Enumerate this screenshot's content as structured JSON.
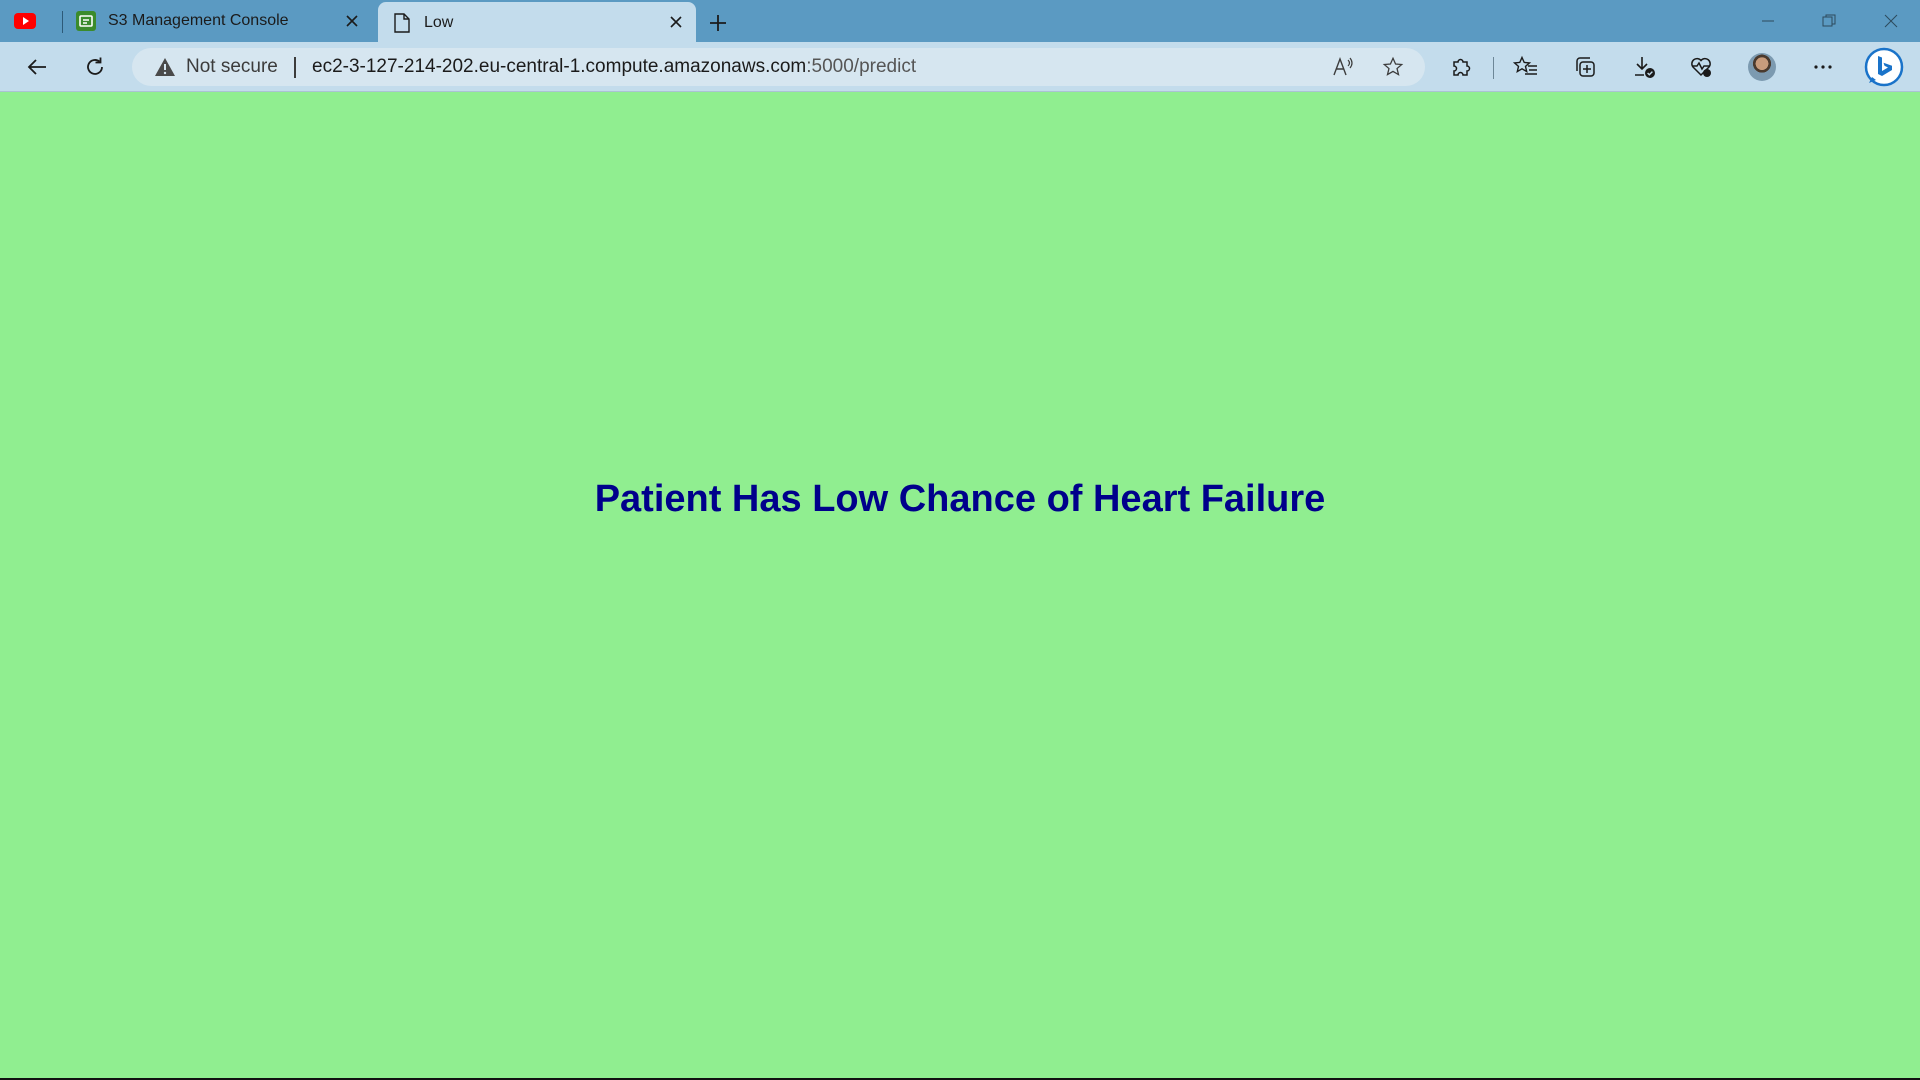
{
  "tabs": [
    {
      "icon": "youtube-icon",
      "label": ""
    },
    {
      "icon": "s3-console-icon",
      "label": "S3 Management Console"
    },
    {
      "icon": "page-icon",
      "label": "Low",
      "active": true
    }
  ],
  "address_bar": {
    "security_label": "Not secure",
    "url_host": "ec2-3-127-214-202.eu-central-1.compute.amazonaws.com",
    "url_rest": ":5000/predict"
  },
  "page": {
    "heading": "Patient Has Low Chance of Heart Failure",
    "background_color": "#90ee90",
    "heading_color": "#00008b"
  },
  "colors": {
    "tabstrip": "#5b9ac2",
    "toolbar": "#c3dcec"
  }
}
